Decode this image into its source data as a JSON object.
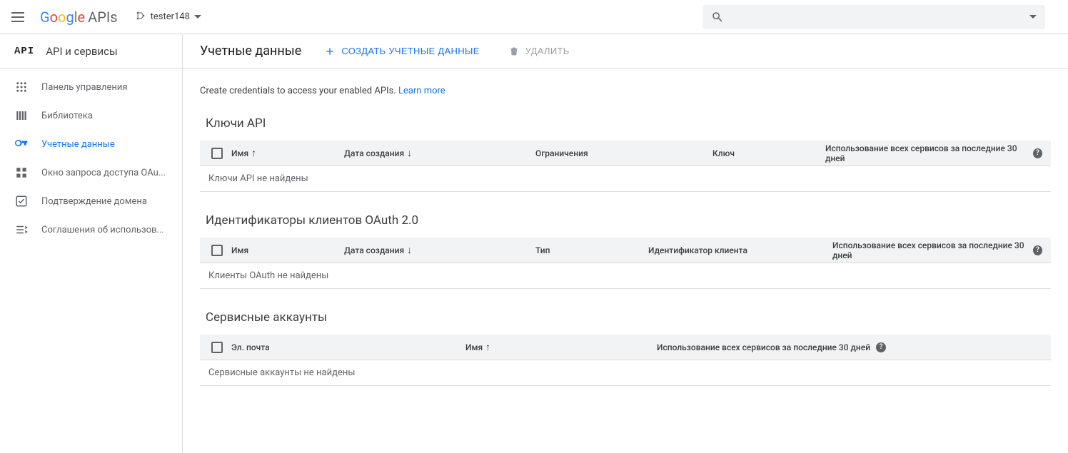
{
  "header": {
    "logo_apis": "APIs",
    "project_name": "tester148"
  },
  "sidebar": {
    "api_mark": "API",
    "title": "API и сервисы",
    "items": [
      {
        "label": "Панель управления"
      },
      {
        "label": "Библиотека"
      },
      {
        "label": "Учетные данные"
      },
      {
        "label": "Окно запроса доступа OAu..."
      },
      {
        "label": "Подтверждение домена"
      },
      {
        "label": "Соглашения об использов..."
      }
    ]
  },
  "page": {
    "title": "Учетные данные",
    "create_label": "Создать учетные данные",
    "delete_label": "Удалить",
    "intro_text": "Create credentials to access your enabled APIs. ",
    "learn_more": "Learn more"
  },
  "tables": {
    "api_keys": {
      "title": "Ключи API",
      "cols": {
        "name": "Имя",
        "created": "Дата создания",
        "limits": "Ограничения",
        "key": "Ключ",
        "usage": "Использование всех сервисов за последние 30 дней"
      },
      "empty": "Ключи API не найдены"
    },
    "oauth": {
      "title": "Идентификаторы клиентов OAuth 2.0",
      "cols": {
        "name": "Имя",
        "created": "Дата создания",
        "type": "Тип",
        "clientid": "Идентификатор клиента",
        "usage": "Использование всех сервисов за последние 30 дней"
      },
      "empty": "Клиенты OAuth не найдены"
    },
    "service": {
      "title": "Сервисные аккаунты",
      "cols": {
        "email": "Эл. почта",
        "name": "Имя",
        "usage": "Использование всех сервисов за последние 30 дней"
      },
      "empty": "Сервисные аккаунты не найдены"
    }
  }
}
